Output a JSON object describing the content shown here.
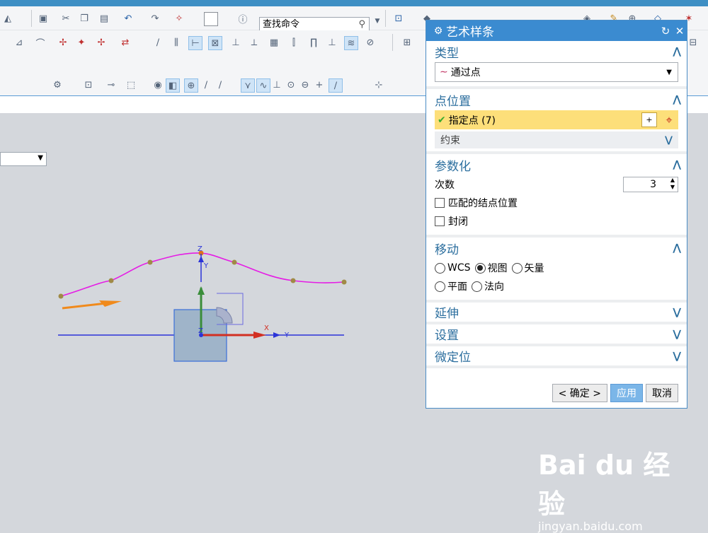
{
  "toolbar": {
    "search_placeholder": "查找命令",
    "icons_row1": [
      "tool-icon",
      "save-icon",
      "cut-icon",
      "copy-icon",
      "paste-icon",
      "undo-icon",
      "redo-icon",
      "snap-icon",
      "color-box-icon",
      "info-icon",
      "search-icon",
      "view-icon",
      "shade-icon",
      "box-icon",
      "folder-icon",
      "render-icon",
      "section-icon",
      "layer-icon",
      "brush-icon",
      "measure-icon",
      "grid-icon",
      "star-icon"
    ],
    "icons_row2": [
      "line-icon",
      "arc-icon",
      "spline-icon",
      "point-icon",
      "plane-icon",
      "trim-icon",
      "extend-icon",
      "offset-icon",
      "split-icon",
      "project-icon",
      "bridge-icon",
      "fillet-icon",
      "chamfer-icon",
      "curve-icon",
      "helix-icon",
      "text-icon",
      "dimension-icon",
      "sketch-icon",
      "grid2-icon",
      "wave-icon"
    ],
    "icons_row3": [
      "filter-icon",
      "select-icon",
      "face-icon",
      "box-select-icon",
      "snap-end-icon",
      "snap-mid-icon",
      "snap-curve-icon",
      "snap-center-icon",
      "snap-point-icon",
      "snap-arc-icon",
      "snap-cross-icon",
      "snap-line-icon",
      "snap-face-icon",
      "snap-pole-icon",
      "snap-add-icon"
    ]
  },
  "dialog": {
    "title": "艺术样条",
    "sections": {
      "type": {
        "label": "类型",
        "value": "通过点"
      },
      "point_position": {
        "label": "点位置",
        "specify": "指定点 (7)",
        "constraint": "约束"
      },
      "parameterization": {
        "label": "参数化",
        "degree_label": "次数",
        "degree_value": "3",
        "match_knots": "匹配的结点位置",
        "closed": "封闭"
      },
      "movement": {
        "label": "移动",
        "options": [
          "WCS",
          "视图",
          "矢量",
          "平面",
          "法向"
        ],
        "selected": "视图"
      },
      "extension": {
        "label": "延伸"
      },
      "settings": {
        "label": "设置"
      },
      "micro_position": {
        "label": "微定位"
      }
    },
    "buttons": {
      "ok": "< 确定 >",
      "apply": "应用",
      "cancel": "取消"
    }
  },
  "viewport": {
    "axis_labels": {
      "z": "Z",
      "y": "Y",
      "x": "X",
      "y2": "Y",
      "z2": "Z"
    },
    "colors": {
      "spline": "#e51ce5",
      "axis_blue": "#2b34d8",
      "axis_red": "#d22f22",
      "axis_green": "#3a8d3a",
      "point": "#a08a46",
      "arrow": "#f08a1c"
    }
  },
  "watermark": {
    "brand": "Bai du 经验",
    "url": "jingyan.baidu.com"
  }
}
